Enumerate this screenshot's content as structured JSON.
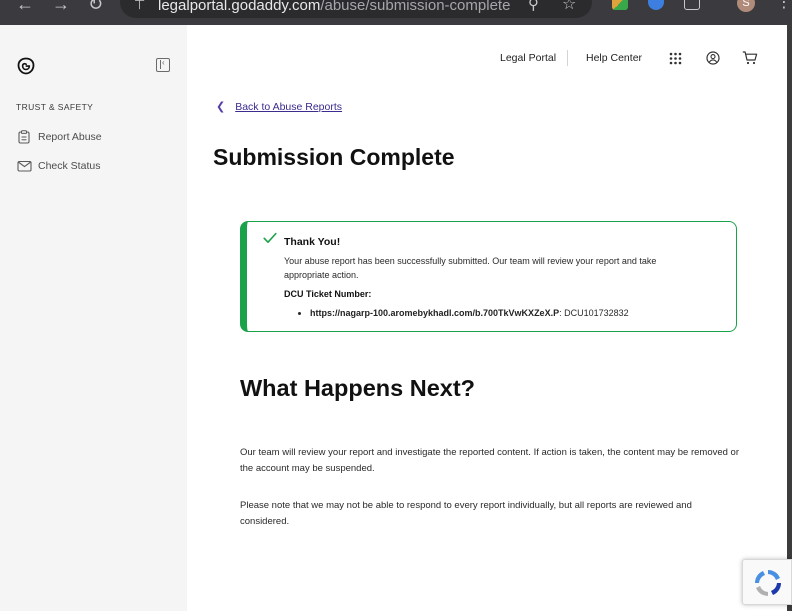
{
  "browser": {
    "url_domain": "legalportal.godaddy.com",
    "url_path": "/abuse/submission-complete",
    "profile_initial": "S"
  },
  "sidebar": {
    "section_title": "TRUST & SAFETY",
    "items": [
      {
        "label": "Report Abuse",
        "icon": "clipboard-icon"
      },
      {
        "label": "Check Status",
        "icon": "envelope-icon"
      }
    ]
  },
  "topnav": {
    "legal_portal": "Legal Portal",
    "help_center": "Help Center"
  },
  "back_link": "Back to Abuse Reports",
  "page_title": "Submission Complete",
  "success": {
    "heading": "Thank You!",
    "body": "Your abuse report has been successfully submitted. Our team will review your report and take appropriate action.",
    "ticket_label": "DCU Ticket Number:",
    "ticket_url": "https://nagarp-100.aromebykhadl.com/b.700TkVwKXZeX.P",
    "ticket_number": ": DCU101732832"
  },
  "next": {
    "heading": "What Happens Next?",
    "para1": "Our team will review your report and investigate the reported content. If action is taken, the content may be removed or the account may be suspended.",
    "para2": "Please note that we may not be able to respond to every report individually, but all reports are reviewed and considered."
  },
  "colors": {
    "success_border": "#1aa24a",
    "link_purple": "#3d2b8e",
    "sidebar_bg": "#f5f5f6"
  }
}
